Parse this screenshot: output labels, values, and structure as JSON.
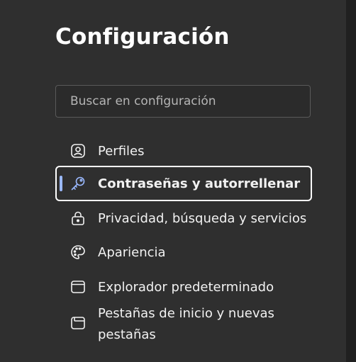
{
  "page": {
    "title": "Configuración"
  },
  "search": {
    "placeholder": "Buscar en configuración"
  },
  "menu": {
    "items": [
      {
        "label": "Perfiles",
        "icon": "profile-icon"
      },
      {
        "label": "Contraseñas y autorrellenar",
        "icon": "key-icon",
        "selected": true
      },
      {
        "label": "Privacidad, búsqueda y servicios",
        "icon": "lock-icon"
      },
      {
        "label": "Apariencia",
        "icon": "palette-icon"
      },
      {
        "label": "Explorador predeterminado",
        "icon": "browser-window-icon"
      },
      {
        "label": "Pestañas de inicio y nuevas pestañas",
        "icon": "new-tab-icon"
      }
    ]
  },
  "colors": {
    "panel": "#2f2f2f",
    "accent": "#9bb9ff",
    "text": "#ffffff"
  }
}
